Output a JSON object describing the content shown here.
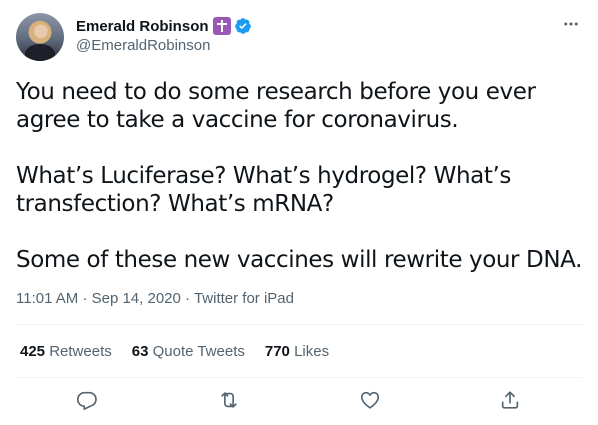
{
  "author": {
    "display_name": "Emerald Robinson",
    "handle": "@EmeraldRobinson"
  },
  "tweet": {
    "text": "You need to do some research before you ever agree to take a vaccine for coronavirus.\n\nWhat’s Luciferase? What’s hydrogel? What’s transfection? What’s mRNA?\n\nSome of these new vaccines will rewrite your DNA.",
    "time": "11:01 AM",
    "date": "Sep 14, 2020",
    "source": "Twitter for iPad",
    "separator": "·"
  },
  "stats": {
    "retweets_count": "425",
    "retweets_label": "Retweets",
    "quotes_count": "63",
    "quotes_label": "Quote Tweets",
    "likes_count": "770",
    "likes_label": "Likes"
  },
  "icons": {
    "badge": "latin-cross-icon",
    "verified": "verified-badge-icon",
    "more": "more-options-icon",
    "reply": "reply-icon",
    "retweet": "retweet-icon",
    "like": "heart-icon",
    "share": "share-icon"
  },
  "colors": {
    "text_primary": "#0f1419",
    "text_secondary": "#536471",
    "verified_blue": "#1d9bf0",
    "badge_purple": "#9b59b6",
    "divider": "#eff3f4"
  }
}
